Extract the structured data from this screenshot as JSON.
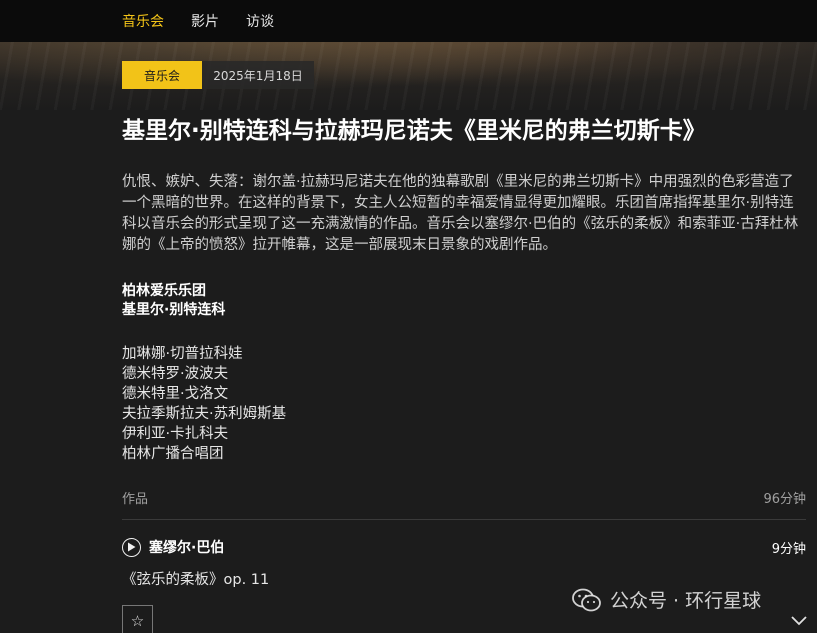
{
  "nav": {
    "items": [
      {
        "label": "音乐会",
        "active": true
      },
      {
        "label": "影片",
        "active": false
      },
      {
        "label": "访谈",
        "active": false
      }
    ]
  },
  "meta": {
    "category": "音乐会",
    "date": "2025年1月18日"
  },
  "title": "基里尔·别特连科与拉赫玛尼诺夫《里米尼的弗兰切斯卡》",
  "description": "仇恨、嫉妒、失落：谢尔盖·拉赫玛尼诺夫在他的独幕歌剧《里米尼的弗兰切斯卡》中用强烈的色彩营造了一个黑暗的世界。在这样的背景下，女主人公短暂的幸福爱情显得更加耀眼。乐团首席指挥基里尔·别特连科以音乐会的形式呈现了这一充满激情的作品。音乐会以塞缪尔·巴伯的《弦乐的柔板》和索菲亚·古拜杜林娜的《上帝的愤怒》拉开帷幕，这是一部展现末日景象的戏剧作品。",
  "ensemble": {
    "orchestra": "柏林爱乐乐团",
    "conductor": "基里尔·别特连科"
  },
  "performers": [
    "加琳娜·切普拉科娃",
    "德米特罗·波波夫",
    "德米特里·戈洛文",
    "夫拉季斯拉夫·苏利姆斯基",
    "伊利亚·卡扎科夫",
    "柏林广播合唱团"
  ],
  "works": {
    "label": "作品",
    "total_duration": "96分钟",
    "items": [
      {
        "composer": "塞缪尔·巴伯",
        "duration": "9分钟",
        "title": "《弦乐的柔板》op. 11"
      }
    ]
  },
  "watermark": "公众号 · 环行星球",
  "icons": {
    "play": "play-circle-icon",
    "star": "star-outline-icon",
    "chevron": "chevron-down-icon",
    "wechat": "wechat-icon"
  },
  "colors": {
    "accent": "#f2c318",
    "background": "#1c1c1c",
    "nav_bg": "#0b0b0b"
  }
}
